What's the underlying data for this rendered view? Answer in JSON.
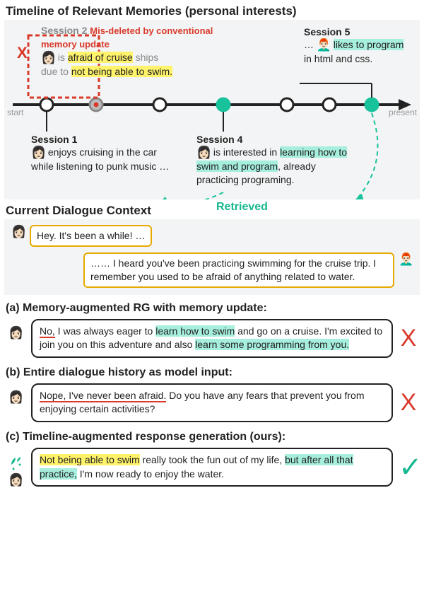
{
  "headers": {
    "timeline": "Timeline of Relevant Memories (personal interests)",
    "current_dialogue": "Current Dialogue Context",
    "a": "(a) Memory-augmented RG with memory update:",
    "b": "(b) Entire dialogue history as model input:",
    "c": "(c) Timeline-augmented response generation (ours):",
    "retrieved": "Retrieved"
  },
  "timeline": {
    "start": "start",
    "present": "present",
    "red_x": "X",
    "session2": {
      "label": "Session 2",
      "red_note": "Mis-deleted by conventional memory update",
      "t1_pre": " is ",
      "t1_hl": "afraid of cruise",
      "t1_post": " ships",
      "t2_pre": "due to ",
      "t2_hl": "not being able to swim.",
      "t2_post": ""
    },
    "session5": {
      "label": "Session 5",
      "t1_pre": "… ",
      "t1_hl": "likes to program",
      "t1_post": "",
      "t2": "in html and css."
    },
    "session1": {
      "label": "Session 1",
      "text": " enjoys cruising in the car while listening to punk music …"
    },
    "session4": {
      "label": "Session 4",
      "t1_pre": " is interested in ",
      "t1_hl1": "learning how to swim and program",
      "t1_mid": ", already practicing programing."
    }
  },
  "dialogue": {
    "user_msg": "Hey. It's been a while! …",
    "partner_msg": "…… I heard you've been practicing swimming for the cruise trip. I remember you used to be afraid of anything related to water."
  },
  "responses": {
    "a": {
      "ul": "No,",
      "pre": " I was always eager to ",
      "hl1": "learn how to swim",
      "mid1": " and go on a cruise. I'm excited to join you on this adventure and also ",
      "hl2": "learn some programming from you.",
      "mark": "X"
    },
    "b": {
      "ul": "Nope, I've never been afraid.",
      "post": " Do you have any fears that prevent you from enjoying certain activities?",
      "mark": "X"
    },
    "c": {
      "hl1": "Not being able to swim",
      "mid1": " really took the fun out of my life, ",
      "hl2": "but after all that practice,",
      "mid2": " I'm now ready to enjoy the water.",
      "mark": "✓"
    }
  }
}
